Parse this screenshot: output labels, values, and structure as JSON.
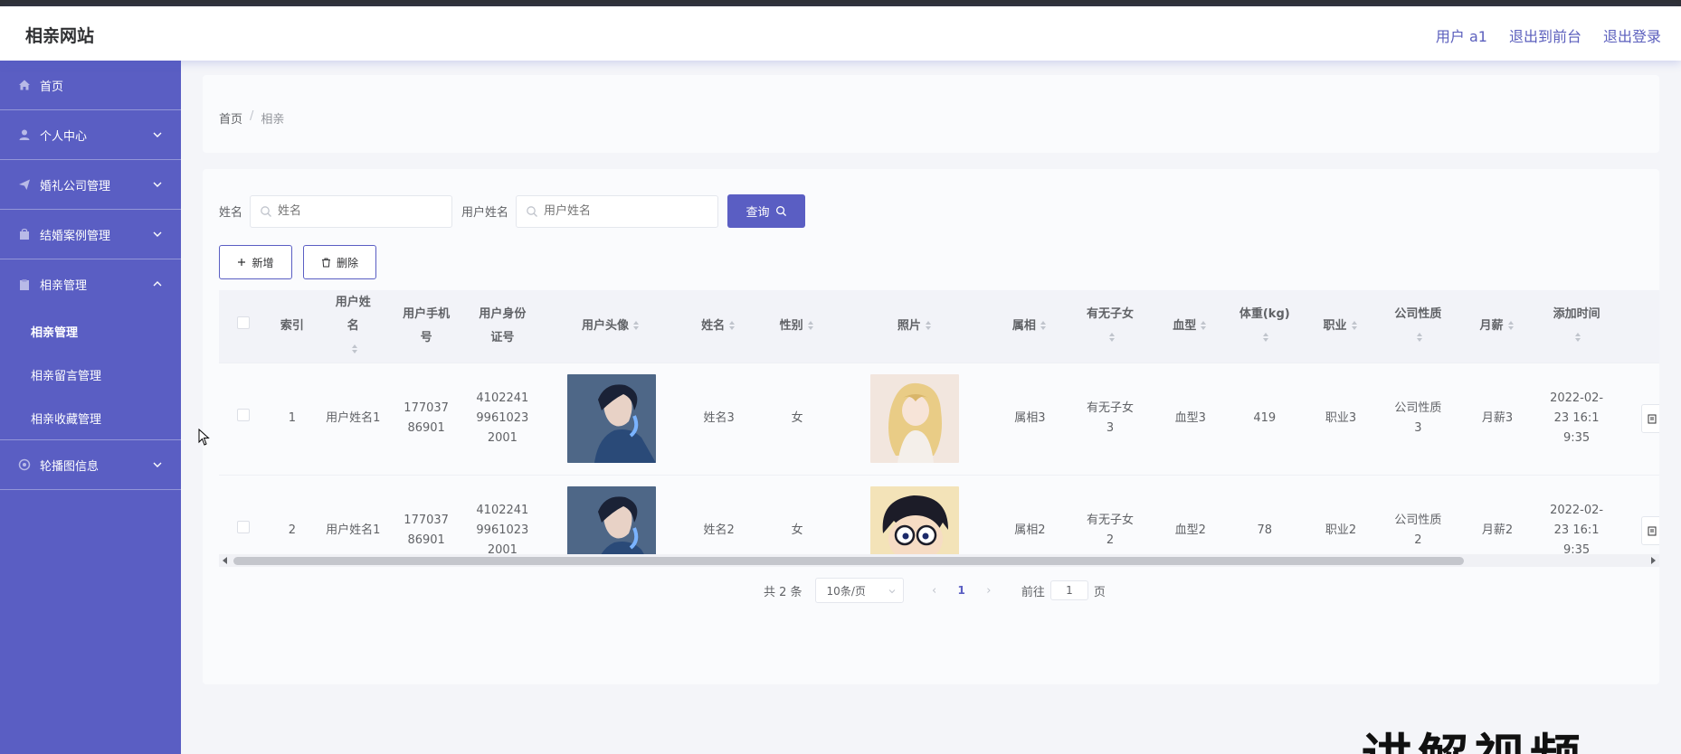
{
  "header": {
    "site_title": "相亲网站",
    "user_label": "用户 a1",
    "back_to_front": "退出到前台",
    "logout": "退出登录"
  },
  "sidebar": {
    "home": "首页",
    "items": [
      {
        "label": "个人中心",
        "icon": "person-icon",
        "expanded": false
      },
      {
        "label": "婚礼公司管理",
        "icon": "send-icon",
        "expanded": false
      },
      {
        "label": "结婚案例管理",
        "icon": "bag-icon",
        "expanded": false
      },
      {
        "label": "相亲管理",
        "icon": "clipboard-icon",
        "expanded": true
      },
      {
        "label": "轮播图信息",
        "icon": "settings-icon",
        "expanded": false
      }
    ],
    "sub_items": [
      "相亲管理",
      "相亲留言管理",
      "相亲收藏管理"
    ]
  },
  "breadcrumb": {
    "home": "首页",
    "sep": "/",
    "current": "相亲"
  },
  "search": {
    "name_label": "姓名",
    "name_placeholder": "姓名",
    "username_label": "用户姓名",
    "username_placeholder": "用户姓名",
    "query_button": "查询"
  },
  "actions": {
    "add": "新增",
    "delete": "删除"
  },
  "table": {
    "columns": [
      "索引",
      "用户姓名",
      "用户手机号",
      "用户身份证号",
      "用户头像",
      "姓名",
      "性别",
      "照片",
      "属相",
      "有无子女",
      "血型",
      "体重(kg)",
      "职业",
      "公司性质",
      "月薪",
      "添加时间"
    ],
    "rows": [
      {
        "index": "1",
        "username": "用户姓名1",
        "phone": "17703786901",
        "idcard": "410224199610232001",
        "avatar": "anime-boy-avatar",
        "name": "姓名3",
        "gender": "女",
        "photo": "blonde-girl-photo",
        "zodiac": "属相3",
        "children": "有无子女3",
        "blood": "血型3",
        "weight": "419",
        "job": "职业3",
        "company": "公司性质3",
        "salary": "月薪3",
        "added": "2022-02-23 16:19:35",
        "detail": "详"
      },
      {
        "index": "2",
        "username": "用户姓名1",
        "phone": "17703786901",
        "idcard": "410224199610232001",
        "avatar": "anime-boy-avatar",
        "name": "姓名2",
        "gender": "女",
        "photo": "conan-photo",
        "zodiac": "属相2",
        "children": "有无子女2",
        "blood": "血型2",
        "weight": "78",
        "job": "职业2",
        "company": "公司性质2",
        "salary": "月薪2",
        "added": "2022-02-23 16:19:35",
        "detail": "详"
      }
    ]
  },
  "pagination": {
    "total": "共 2 条",
    "page_size": "10条/页",
    "current_page": "1",
    "goto_label": "前往",
    "goto_value": "1",
    "page_unit": "页"
  },
  "overlay_text": "讲解视频",
  "colors": {
    "accent": "#5a5ec3",
    "header_link": "#5b5fbd"
  }
}
